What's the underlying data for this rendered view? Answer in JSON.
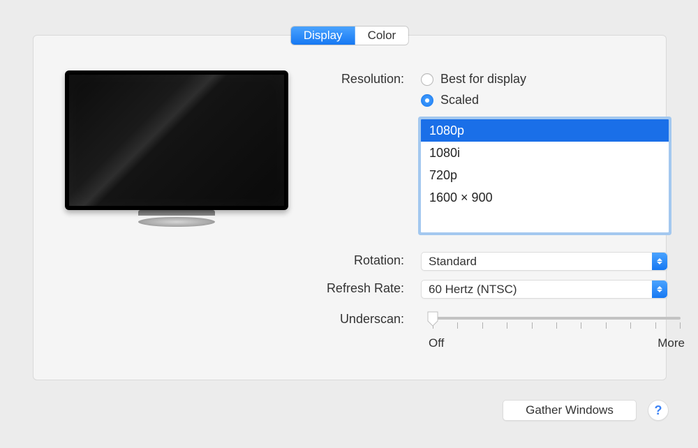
{
  "tabs": {
    "display": "Display",
    "color": "Color",
    "active": "display"
  },
  "labels": {
    "resolution": "Resolution:",
    "rotation": "Rotation:",
    "refresh_rate": "Refresh Rate:",
    "underscan": "Underscan:"
  },
  "resolution": {
    "best_label": "Best for display",
    "scaled_label": "Scaled",
    "selected": "scaled",
    "options": [
      "1080p",
      "1080i",
      "720p",
      "1600 × 900"
    ],
    "options_selected_index": 0
  },
  "rotation": {
    "value": "Standard"
  },
  "refresh_rate": {
    "value": "60 Hertz (NTSC)"
  },
  "underscan": {
    "min_label": "Off",
    "max_label": "More",
    "ticks": 11,
    "value": 0
  },
  "buttons": {
    "gather_windows": "Gather Windows",
    "help_glyph": "?"
  }
}
